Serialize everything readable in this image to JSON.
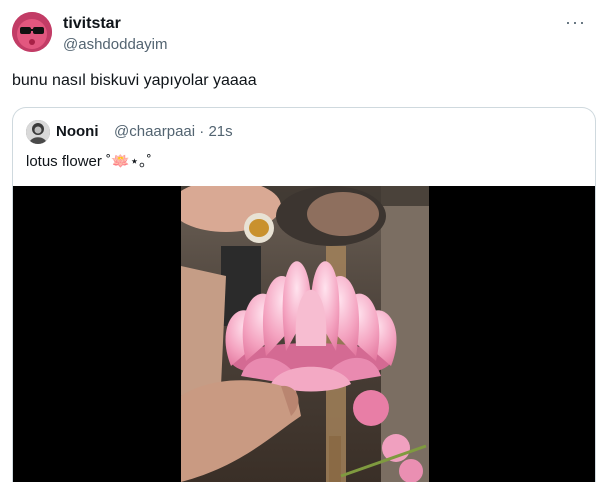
{
  "tweet": {
    "author_name": "tivitstar",
    "author_handle": "@ashdoddayim",
    "more_icon": "more-horizontal-icon",
    "text": "bunu nasıl biskuvi yapıyolar yaaaa"
  },
  "quoted_tweet": {
    "author_name": "Nooni",
    "author_handle": "@chaarpaai · 21s",
    "text": "lotus flower ˚🪷⋆｡˚",
    "media": {
      "type": "video",
      "subject": "pink lotus flower held in hand"
    }
  },
  "colors": {
    "text": "#0f1419",
    "secondary": "#536471",
    "border": "#cfd9de",
    "lotus": "#f2a3be"
  }
}
